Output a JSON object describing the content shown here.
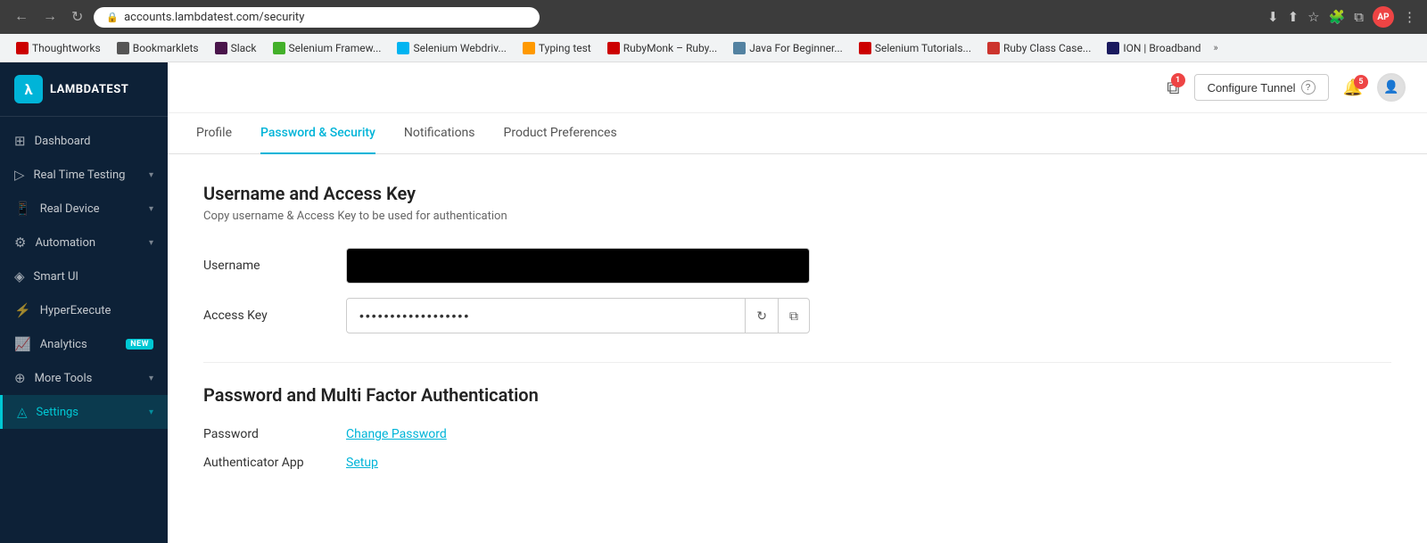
{
  "browser": {
    "back_btn": "←",
    "forward_btn": "→",
    "refresh_btn": "↻",
    "url": "accounts.lambdatest.com/security",
    "download_icon": "⬇",
    "share_icon": "⬆",
    "bookmark_star": "☆",
    "extensions_icon": "🧩",
    "window_icon": "⧉",
    "profile_initials": "AP",
    "menu_icon": "⋮"
  },
  "bookmarks": [
    {
      "id": "thoughtworks",
      "label": "Thoughtworks",
      "color_class": "bm-thoughtworks"
    },
    {
      "id": "bookmarklets",
      "label": "Bookmarklets",
      "color_class": "bm-bookmarklets"
    },
    {
      "id": "slack",
      "label": "Slack",
      "color_class": "bm-slack"
    },
    {
      "id": "selenium-fw",
      "label": "Selenium Framew...",
      "color_class": "bm-selenium"
    },
    {
      "id": "selenium-wd",
      "label": "Selenium Webdriv...",
      "color_class": "bm-selenium2"
    },
    {
      "id": "typing-test",
      "label": "Typing test",
      "color_class": "bm-typing"
    },
    {
      "id": "rubymonk",
      "label": "RubyMonk – Ruby...",
      "color_class": "bm-rubymonk"
    },
    {
      "id": "java-beginner",
      "label": "Java For Beginner...",
      "color_class": "bm-java"
    },
    {
      "id": "selenium-tut",
      "label": "Selenium Tutorials...",
      "color_class": "bm-selenium3"
    },
    {
      "id": "ruby-class",
      "label": "Ruby Class Case...",
      "color_class": "bm-ruby"
    },
    {
      "id": "ion",
      "label": "ION | Broadband",
      "color_class": "bm-ion"
    }
  ],
  "sidebar": {
    "logo_text": "LAMBDATEST",
    "items": [
      {
        "id": "dashboard",
        "label": "Dashboard",
        "icon": "⊞",
        "has_chevron": false,
        "badge": null
      },
      {
        "id": "real-time-testing",
        "label": "Real Time Testing",
        "icon": "▷",
        "has_chevron": true,
        "badge": null
      },
      {
        "id": "real-device",
        "label": "Real Device",
        "icon": "📱",
        "has_chevron": true,
        "badge": null
      },
      {
        "id": "automation",
        "label": "Automation",
        "icon": "⚙",
        "has_chevron": true,
        "badge": null
      },
      {
        "id": "smart-ui",
        "label": "Smart UI",
        "icon": "◈",
        "has_chevron": false,
        "badge": null
      },
      {
        "id": "hyperexecute",
        "label": "HyperExecute",
        "icon": "⚡",
        "has_chevron": false,
        "badge": null
      },
      {
        "id": "analytics",
        "label": "Analytics",
        "icon": "📈",
        "has_chevron": false,
        "badge": "NEW"
      },
      {
        "id": "more-tools",
        "label": "More Tools",
        "icon": "⊕",
        "has_chevron": true,
        "badge": null
      },
      {
        "id": "settings",
        "label": "Settings",
        "icon": "◬",
        "has_chevron": true,
        "badge": null,
        "active": true
      }
    ]
  },
  "header": {
    "configure_tunnel_label": "Configure Tunnel",
    "help_icon": "?",
    "notif_badge_count": "5",
    "status_badge_count": "1"
  },
  "tabs": [
    {
      "id": "profile",
      "label": "Profile",
      "active": false
    },
    {
      "id": "password-security",
      "label": "Password & Security",
      "active": true
    },
    {
      "id": "notifications",
      "label": "Notifications",
      "active": false
    },
    {
      "id": "product-preferences",
      "label": "Product Preferences",
      "active": false
    }
  ],
  "content": {
    "username_access_section": {
      "title": "Username and Access Key",
      "subtitle": "Copy username & Access Key to be used for authentication",
      "username_label": "Username",
      "username_value": "",
      "access_key_label": "Access Key",
      "access_key_value": "••••••••••••••••••",
      "refresh_icon": "↻",
      "copy_icon": "⧉"
    },
    "mfa_section": {
      "title": "Password and Multi Factor Authentication",
      "password_label": "Password",
      "change_password_label": "Change Password",
      "authenticator_label": "Authenticator App",
      "setup_label": "Setup"
    }
  }
}
